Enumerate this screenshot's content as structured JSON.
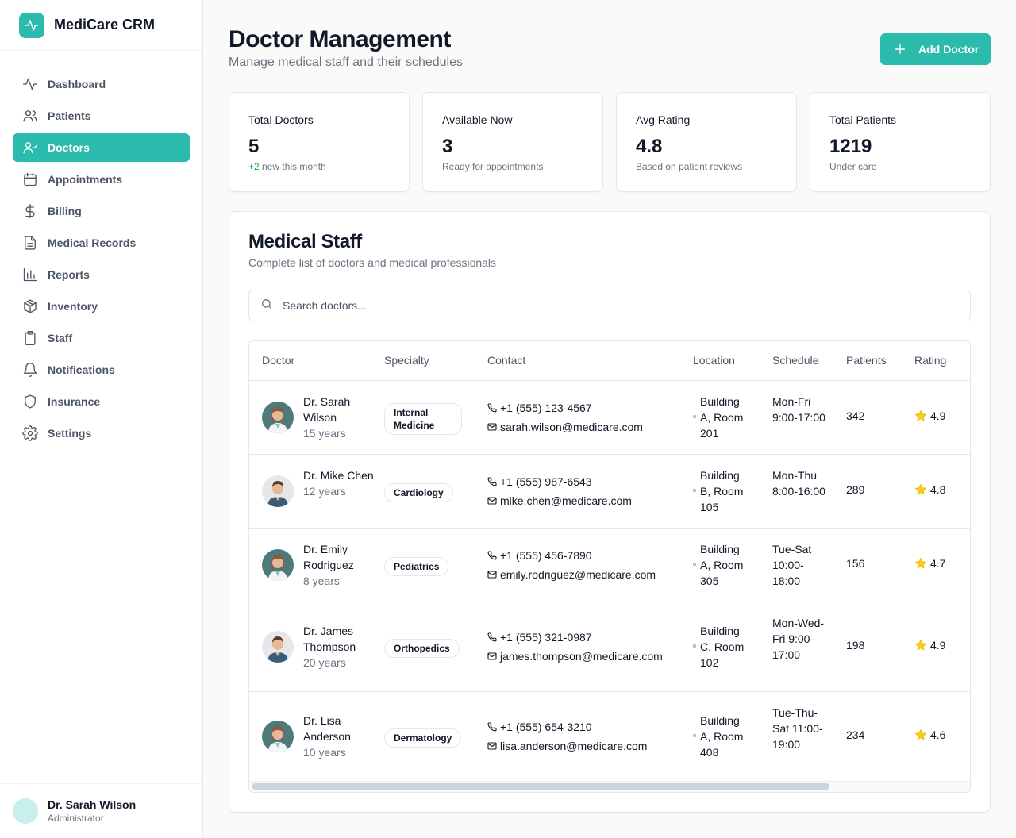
{
  "app": {
    "name": "MediCare CRM"
  },
  "sidebar": {
    "items": [
      {
        "label": "Dashboard",
        "icon": "activity-icon"
      },
      {
        "label": "Patients",
        "icon": "users-icon"
      },
      {
        "label": "Doctors",
        "icon": "user-check-icon",
        "active": true
      },
      {
        "label": "Appointments",
        "icon": "calendar-icon"
      },
      {
        "label": "Billing",
        "icon": "dollar-icon"
      },
      {
        "label": "Medical Records",
        "icon": "file-text-icon"
      },
      {
        "label": "Reports",
        "icon": "bar-chart-icon"
      },
      {
        "label": "Inventory",
        "icon": "package-icon"
      },
      {
        "label": "Staff",
        "icon": "clipboard-icon"
      },
      {
        "label": "Notifications",
        "icon": "bell-icon"
      },
      {
        "label": "Insurance",
        "icon": "shield-icon"
      },
      {
        "label": "Settings",
        "icon": "gear-icon"
      }
    ],
    "user": {
      "name": "Dr. Sarah Wilson",
      "role": "Administrator"
    }
  },
  "header": {
    "title": "Doctor Management",
    "subtitle": "Manage medical staff and their schedules",
    "add_label": "Add Doctor"
  },
  "stats": [
    {
      "label": "Total Doctors",
      "value": "5",
      "sub_highlight": "+2",
      "sub": " new this month"
    },
    {
      "label": "Available Now",
      "value": "3",
      "sub_highlight": "",
      "sub": "Ready for appointments"
    },
    {
      "label": "Avg Rating",
      "value": "4.8",
      "sub_highlight": "",
      "sub": "Based on patient reviews"
    },
    {
      "label": "Total Patients",
      "value": "1219",
      "sub_highlight": "",
      "sub": "Under care"
    }
  ],
  "staff": {
    "title": "Medical Staff",
    "subtitle": "Complete list of doctors and medical professionals",
    "search_placeholder": "Search doctors...",
    "columns": [
      "Doctor",
      "Specialty",
      "Contact",
      "Location",
      "Schedule",
      "Patients",
      "Rating"
    ],
    "rows": [
      {
        "name": "Dr. Sarah Wilson",
        "years": "15 years",
        "specialty": "Internal Medicine",
        "phone": "+1 (555) 123-4567",
        "email": "sarah.wilson@medicare.com",
        "location": "Building A, Room 201",
        "schedule": "Mon-Fri 9:00-17:00",
        "patients": "342",
        "rating": "4.9",
        "gender": "f"
      },
      {
        "name": "Dr. Mike Chen",
        "years": "12 years",
        "specialty": "Cardiology",
        "phone": "+1 (555) 987-6543",
        "email": "mike.chen@medicare.com",
        "location": "Building B, Room 105",
        "schedule": "Mon-Thu 8:00-16:00",
        "patients": "289",
        "rating": "4.8",
        "gender": "m"
      },
      {
        "name": "Dr. Emily Rodriguez",
        "years": "8 years",
        "specialty": "Pediatrics",
        "phone": "+1 (555) 456-7890",
        "email": "emily.rodriguez@medicare.com",
        "location": "Building A, Room 305",
        "schedule": "Tue-Sat 10:00-18:00",
        "patients": "156",
        "rating": "4.7",
        "gender": "f"
      },
      {
        "name": "Dr. James Thompson",
        "years": "20 years",
        "specialty": "Orthopedics",
        "phone": "+1 (555) 321-0987",
        "email": "james.thompson@medicare.com",
        "location": "Building C, Room 102",
        "schedule": "Mon-Wed-Fri 9:00-17:00",
        "patients": "198",
        "rating": "4.9",
        "gender": "m"
      },
      {
        "name": "Dr. Lisa Anderson",
        "years": "10 years",
        "specialty": "Dermatology",
        "phone": "+1 (555) 654-3210",
        "email": "lisa.anderson@medicare.com",
        "location": "Building A, Room 408",
        "schedule": "Tue-Thu-Sat 11:00-19:00",
        "patients": "234",
        "rating": "4.6",
        "gender": "f"
      }
    ]
  },
  "colors": {
    "accent": "#2bbbad",
    "star": "#facc15",
    "positive": "#16a34a"
  }
}
